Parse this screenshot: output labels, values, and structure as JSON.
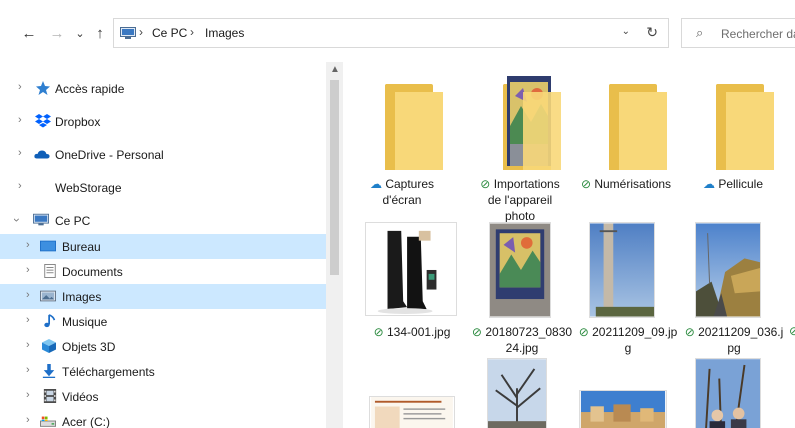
{
  "toolbar": {
    "back": "←",
    "forward": "→",
    "recent": "⌄",
    "up": "↑"
  },
  "address": {
    "crumbs": [
      "Ce PC",
      "Images"
    ],
    "separator": "›",
    "dropdown": "⌄",
    "refresh": "↻"
  },
  "search": {
    "placeholder": "Rechercher da"
  },
  "sidebar": {
    "items": [
      {
        "label": "Accès rapide",
        "icon": "star-icon"
      },
      {
        "label": "Dropbox",
        "icon": "dropbox-icon"
      },
      {
        "label": "OneDrive - Personal",
        "icon": "cloud-icon"
      },
      {
        "label": "WebStorage",
        "icon": ""
      },
      {
        "label": "Ce PC",
        "icon": "computer-icon"
      },
      {
        "label": "Bureau",
        "icon": "desktop-icon"
      },
      {
        "label": "Documents",
        "icon": "document-icon"
      },
      {
        "label": "Images",
        "icon": "pictures-icon"
      },
      {
        "label": "Musique",
        "icon": "music-icon"
      },
      {
        "label": "Objets 3D",
        "icon": "cube-icon"
      },
      {
        "label": "Téléchargements",
        "icon": "download-icon"
      },
      {
        "label": "Vidéos",
        "icon": "film-icon"
      },
      {
        "label": "Acer (C:)",
        "icon": "drive-icon"
      }
    ]
  },
  "status_icons": {
    "cloud": "☁",
    "ok": "⊘"
  },
  "files": [
    {
      "name": "Captures d'écran",
      "lines": [
        "Captures",
        "d'écran"
      ],
      "status": "cloud",
      "kind": "folder"
    },
    {
      "name": "Importations de l'appareil photo",
      "lines": [
        "Importations",
        "de l'appareil",
        "photo"
      ],
      "status": "ok",
      "kind": "folder-photo"
    },
    {
      "name": "Numérisations",
      "lines": [
        "Numérisations"
      ],
      "status": "ok",
      "kind": "folder"
    },
    {
      "name": "Pellicule",
      "lines": [
        "Pellicule"
      ],
      "status": "cloud",
      "kind": "folder"
    },
    {
      "name": "134-001.jpg",
      "lines": [
        "134-001.jpg"
      ],
      "status": "ok",
      "kind": "boots"
    },
    {
      "name": "20180723_083024.jpg",
      "lines": [
        "20180723_0830",
        "24.jpg"
      ],
      "status": "ok",
      "kind": "painting"
    },
    {
      "name": "20211209_09.jpg",
      "lines": [
        "20211209_09.jp",
        "g"
      ],
      "status": "ok",
      "kind": "pole"
    },
    {
      "name": "20211209_036.jpg",
      "lines": [
        "20211209_036.j",
        "pg"
      ],
      "status": "ok",
      "kind": "road"
    }
  ]
}
